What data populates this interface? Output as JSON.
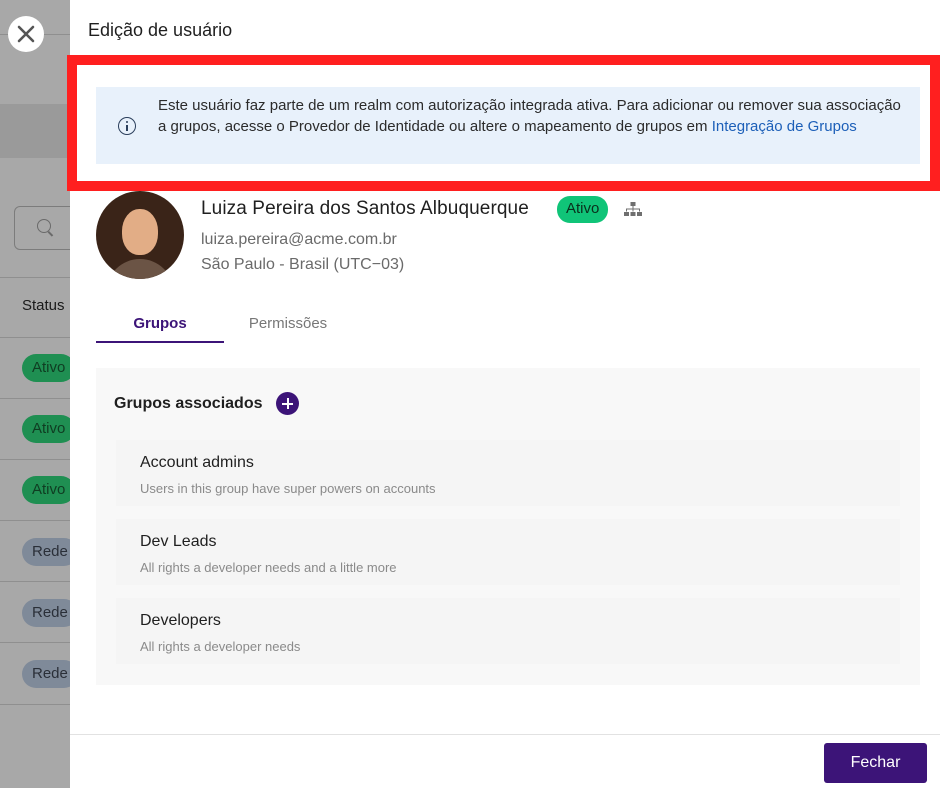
{
  "drawer": {
    "title": "Edição de usuário",
    "info": {
      "text": "Este usuário faz parte de um realm com autorização integrada ativa. Para adicionar ou remover sua associação a grupos, acesse o Provedor de Identidade ou altere o mapeamento de grupos em ",
      "link": "Integração de Grupos"
    },
    "user": {
      "name": "Luiza Pereira dos Santos Albuquerque",
      "status": "Ativo",
      "email": "luiza.pereira@acme.com.br",
      "location": "São Paulo - Brasil (UTC−03)"
    },
    "tabs": [
      {
        "label": "Grupos",
        "active": true
      },
      {
        "label": "Permissões",
        "active": false
      }
    ],
    "groups": {
      "title": "Grupos associados",
      "items": [
        {
          "name": "Account admins",
          "description": "Users in this group have super powers on accounts"
        },
        {
          "name": "Dev Leads",
          "description": "All rights a developer needs and a little more"
        },
        {
          "name": "Developers",
          "description": "All rights a developer needs"
        }
      ]
    },
    "footer": {
      "close_label": "Fechar"
    }
  },
  "background": {
    "status_header": "Status",
    "pills": [
      "Ativo",
      "Ativo",
      "Ativo",
      "Rede",
      "Rede",
      "Rede"
    ]
  },
  "colors": {
    "accent": "#3c1478",
    "active_status": "#10c478",
    "info_bg": "#e8f1fb",
    "highlight": "#ff1f1f",
    "link": "#1c5fb8"
  }
}
